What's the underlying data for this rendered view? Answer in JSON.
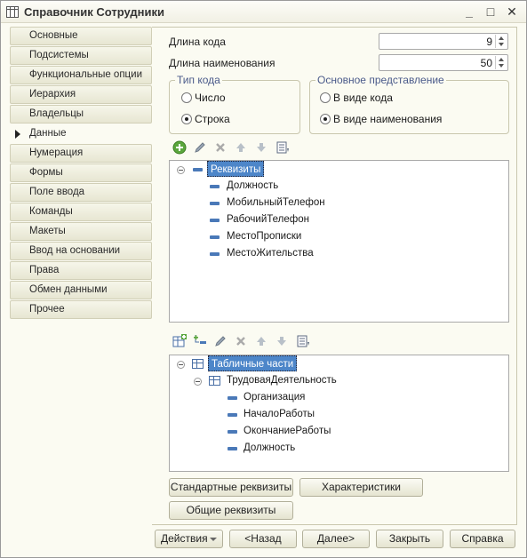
{
  "window": {
    "title": "Справочник Сотрудники",
    "controls": [
      "_",
      "□",
      "✕"
    ]
  },
  "tabs": [
    {
      "label": "Основные"
    },
    {
      "label": "Подсистемы"
    },
    {
      "label": "Функциональные опции"
    },
    {
      "label": "Иерархия"
    },
    {
      "label": "Владельцы"
    },
    {
      "label": "Данные",
      "active": true
    },
    {
      "label": "Нумерация"
    },
    {
      "label": "Формы"
    },
    {
      "label": "Поле ввода"
    },
    {
      "label": "Команды"
    },
    {
      "label": "Макеты"
    },
    {
      "label": "Ввод на основании"
    },
    {
      "label": "Права"
    },
    {
      "label": "Обмен данными"
    },
    {
      "label": "Прочее"
    }
  ],
  "fields": {
    "code_length": {
      "label": "Длина кода",
      "value": "9"
    },
    "name_length": {
      "label": "Длина наименования",
      "value": "50"
    }
  },
  "code_type": {
    "title": "Тип кода",
    "options": [
      "Число",
      "Строка"
    ],
    "selected": "Строка"
  },
  "main_presentation": {
    "title": "Основное представление",
    "options": [
      "В виде кода",
      "В виде наименования"
    ],
    "selected": "В виде наименования"
  },
  "requisites_tree": {
    "root": "Реквизиты",
    "items": [
      "Должность",
      "МобильныйТелефон",
      "РабочийТелефон",
      "МестоПрописки",
      "МестоЖительства"
    ]
  },
  "tabular_tree": {
    "root": "Табличные части",
    "table": "ТрудоваяДеятельность",
    "items": [
      "Организация",
      "НачалоРаботы",
      "ОкончаниеРаботы",
      "Должность"
    ]
  },
  "panel_buttons": {
    "standard": "Стандартные реквизиты",
    "characteristics": "Характеристики",
    "common": "Общие реквизиты"
  },
  "footer": {
    "actions": "Действия",
    "back": "<Назад",
    "next": "Далее>",
    "close": "Закрыть",
    "help": "Справка"
  },
  "colors": {
    "window_bg": "#fbfbf2",
    "selection": "#4d86c9",
    "group_title": "#4a5a8a"
  }
}
